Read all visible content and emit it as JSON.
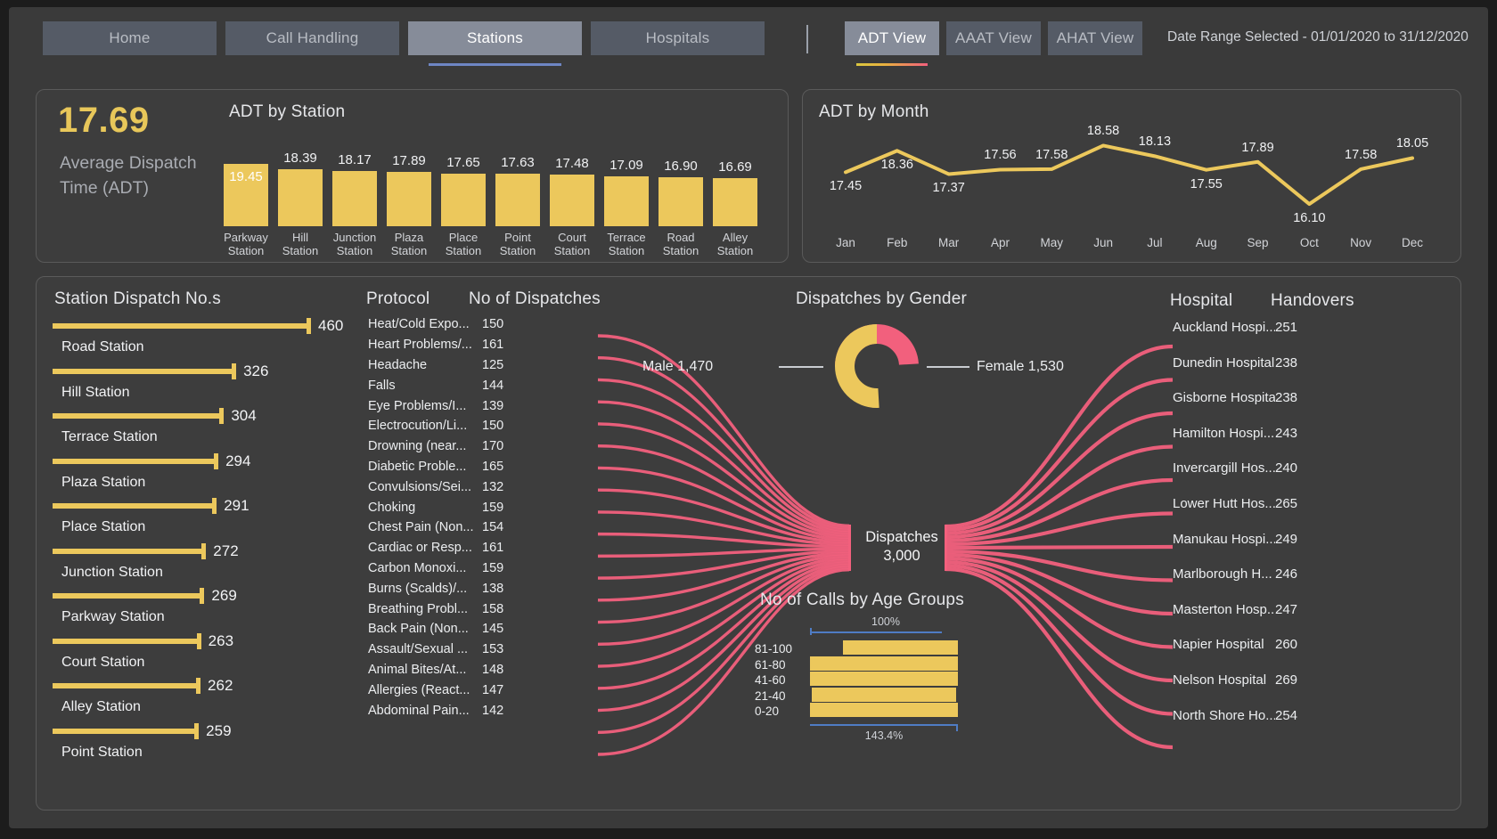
{
  "nav": {
    "tabs": [
      {
        "label": "Home",
        "active": false
      },
      {
        "label": "Call Handling",
        "active": false
      },
      {
        "label": "Stations",
        "active": true
      },
      {
        "label": "Hospitals",
        "active": false
      }
    ],
    "view_tabs": [
      {
        "label": "ADT View",
        "active": true
      },
      {
        "label": "AAAT View",
        "active": false
      },
      {
        "label": "AHAT View",
        "active": false
      }
    ],
    "date_range": "Date Range Selected - 01/01/2020 to 31/12/2020"
  },
  "kpi": {
    "value": "17.69",
    "label": "Average Dispatch Time (ADT)"
  },
  "adt_by_station": {
    "title": "ADT by Station",
    "chart_data": {
      "type": "bar",
      "title": "ADT by Station",
      "xlabel": "",
      "ylabel": "ADT",
      "ylim": [
        0,
        20
      ],
      "categories": [
        "Parkway Station",
        "Hill Station",
        "Junction Station",
        "Plaza Station",
        "Place Station",
        "Point Station",
        "Court Station",
        "Terrace Station",
        "Road Station",
        "Alley Station"
      ],
      "labels_two_line": [
        "Parkway\nStation",
        "Hill\nStation",
        "Junction\nStation",
        "Plaza\nStation",
        "Place\nStation",
        "Point\nStation",
        "Court\nStation",
        "Terrace\nStation",
        "Road\nStation",
        "Alley\nStation"
      ],
      "values": [
        19.45,
        18.39,
        18.17,
        17.89,
        17.65,
        17.63,
        17.48,
        17.09,
        16.9,
        16.69
      ],
      "highlighted_index": 0
    }
  },
  "adt_by_month": {
    "title": "ADT by Month",
    "chart_data": {
      "type": "line",
      "title": "ADT by Month",
      "xlabel": "",
      "ylabel": "ADT",
      "ylim": [
        15.8,
        18.9
      ],
      "categories": [
        "Jan",
        "Feb",
        "Mar",
        "Apr",
        "May",
        "Jun",
        "Jul",
        "Aug",
        "Sep",
        "Oct",
        "Nov",
        "Dec"
      ],
      "values": [
        17.45,
        18.36,
        17.37,
        17.56,
        17.58,
        18.58,
        18.13,
        17.55,
        17.89,
        16.1,
        17.58,
        18.05
      ],
      "label_positions": [
        "below",
        "below",
        "below",
        "above",
        "above",
        "above",
        "above",
        "below",
        "above",
        "below",
        "above",
        "above"
      ]
    }
  },
  "station_dispatch": {
    "title": "Station Dispatch No.s",
    "chart_data": {
      "type": "bar",
      "orientation": "horizontal",
      "title": "Station Dispatch No.s",
      "categories": [
        "Road Station",
        "Hill Station",
        "Terrace Station",
        "Plaza Station",
        "Place Station",
        "Junction Station",
        "Parkway Station",
        "Court Station",
        "Alley Station",
        "Point Station"
      ],
      "values": [
        460,
        326,
        304,
        294,
        291,
        272,
        269,
        263,
        262,
        259
      ],
      "xlim": [
        0,
        460
      ]
    }
  },
  "protocol_table": {
    "headers": [
      "Protocol",
      "No of Dispatches"
    ],
    "rows": [
      {
        "protocol": "Heat/Cold Expo...",
        "dispatches": "150"
      },
      {
        "protocol": "Heart Problems/...",
        "dispatches": "161"
      },
      {
        "protocol": "Headache",
        "dispatches": "125"
      },
      {
        "protocol": "Falls",
        "dispatches": "144"
      },
      {
        "protocol": "Eye Problems/I...",
        "dispatches": "139"
      },
      {
        "protocol": "Electrocution/Li...",
        "dispatches": "150"
      },
      {
        "protocol": "Drowning (near...",
        "dispatches": "170"
      },
      {
        "protocol": "Diabetic Proble...",
        "dispatches": "165"
      },
      {
        "protocol": "Convulsions/Sei...",
        "dispatches": "132"
      },
      {
        "protocol": "Choking",
        "dispatches": "159"
      },
      {
        "protocol": "Chest Pain (Non...",
        "dispatches": "154"
      },
      {
        "protocol": "Cardiac or Resp...",
        "dispatches": "161"
      },
      {
        "protocol": "Carbon Monoxi...",
        "dispatches": "159"
      },
      {
        "protocol": "Burns (Scalds)/...",
        "dispatches": "138"
      },
      {
        "protocol": "Breathing Probl...",
        "dispatches": "158"
      },
      {
        "protocol": "Back Pain (Non...",
        "dispatches": "145"
      },
      {
        "protocol": "Assault/Sexual ...",
        "dispatches": "153"
      },
      {
        "protocol": "Animal Bites/At...",
        "dispatches": "148"
      },
      {
        "protocol": "Allergies (React...",
        "dispatches": "147"
      },
      {
        "protocol": "Abdominal Pain...",
        "dispatches": "142"
      }
    ]
  },
  "sankey": {
    "center_label": "Dispatches",
    "center_value": "3,000",
    "left_node_count": 20,
    "right_node_count": 13,
    "link_color": "#f2607d"
  },
  "gender_donut": {
    "title": "Dispatches by Gender",
    "chart_data": {
      "type": "pie",
      "title": "Dispatches by Gender",
      "labels": [
        "Male",
        "Female"
      ],
      "values": [
        1470,
        1530
      ],
      "value_labels": [
        "Male 1,470",
        "Female 1,530"
      ],
      "colors": [
        "#f2607d",
        "#ecc85c"
      ]
    }
  },
  "age_groups": {
    "title": "No of Calls by Age Groups",
    "chart_data": {
      "type": "bar",
      "orientation": "horizontal",
      "title": "No of Calls by Age Groups",
      "categories": [
        "81-100",
        "61-80",
        "41-60",
        "21-40",
        "0-20"
      ],
      "percent_labels": [
        "100%",
        "143.4%"
      ],
      "bar_widths_pct": [
        78,
        100,
        100,
        98,
        100
      ],
      "bar_offsets_pct": [
        22,
        0,
        0,
        1,
        0
      ]
    }
  },
  "hospital_table": {
    "headers": [
      "Hospital",
      "Handovers"
    ],
    "rows": [
      {
        "hospital": "Auckland Hospi...",
        "handovers": "251"
      },
      {
        "hospital": "Dunedin Hospital",
        "handovers": "238"
      },
      {
        "hospital": "Gisborne Hospital",
        "handovers": "238"
      },
      {
        "hospital": "Hamilton Hospi...",
        "handovers": "243"
      },
      {
        "hospital": "Invercargill Hos...",
        "handovers": "240"
      },
      {
        "hospital": "Lower Hutt Hos...",
        "handovers": "265"
      },
      {
        "hospital": "Manukau Hospi...",
        "handovers": "249"
      },
      {
        "hospital": "Marlborough H...",
        "handovers": "246"
      },
      {
        "hospital": "Masterton Hosp...",
        "handovers": "247"
      },
      {
        "hospital": "Napier Hospital",
        "handovers": "260"
      },
      {
        "hospital": "Nelson Hospital",
        "handovers": "269"
      },
      {
        "hospital": "North Shore Ho...",
        "handovers": "254"
      }
    ]
  },
  "colors": {
    "accent_yellow": "#ecc85c",
    "accent_pink": "#f2607d",
    "page_bg": "#3a3a3a",
    "card_bg": "#3d3d3d",
    "tab_inactive": "#555b66",
    "tab_active": "#868c99"
  }
}
